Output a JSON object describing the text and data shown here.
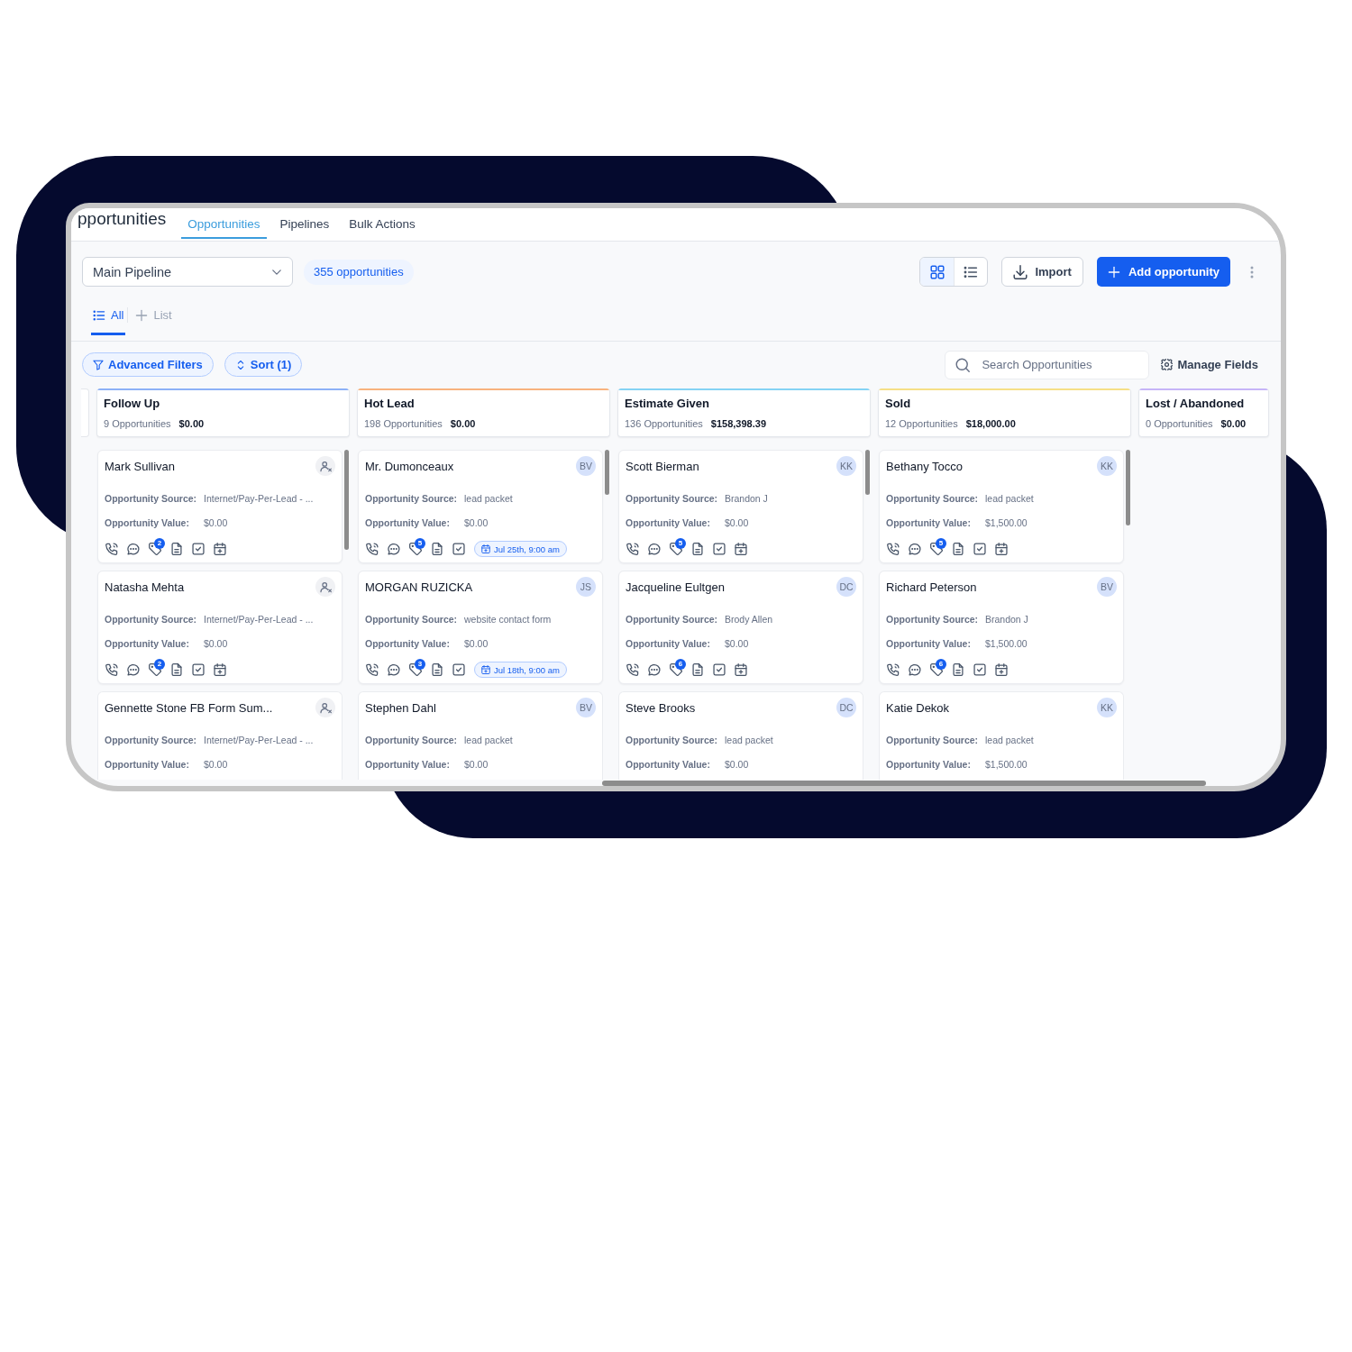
{
  "header": {
    "title": "pportunities",
    "tabs": [
      {
        "label": "Opportunities",
        "selected": true
      },
      {
        "label": "Pipelines",
        "selected": false
      },
      {
        "label": "Bulk Actions",
        "selected": false
      }
    ]
  },
  "toolbar": {
    "pipeline": "Main Pipeline",
    "count": "355 opportunities",
    "view_modes": [
      {
        "kind": "grid",
        "selected": true
      },
      {
        "kind": "list",
        "selected": false
      }
    ],
    "import_button": "Import",
    "add_button": "Add opportunity"
  },
  "list_tabs": {
    "tabs": [
      {
        "label": "All",
        "selected": true
      }
    ],
    "add_list": "List"
  },
  "filters": {
    "buttons": [
      {
        "label": "Advanced Filters",
        "kind": "filter"
      },
      {
        "label": "Sort (1)",
        "kind": "sort"
      }
    ],
    "search": {
      "placeholder": "Search Opportunities"
    },
    "manage_fields": "Manage Fields"
  },
  "board": {
    "columns": [
      {
        "title": "Follow Up",
        "count": "9 Opportunities",
        "total": "$0.00",
        "color": "#8db1f7",
        "cards": [
          {
            "name": "Mark Sullivan",
            "assigned": false,
            "fields": [
              {
                "label": "Opportunity Source:",
                "value": "Internet/Pay-Per-Lead - ..."
              },
              {
                "label": "Opportunity Value:",
                "value": "$0.00"
              }
            ],
            "badge": "2"
          },
          {
            "name": "Natasha Mehta",
            "assigned": false,
            "fields": [
              {
                "label": "Opportunity Source:",
                "value": "Internet/Pay-Per-Lead - ..."
              },
              {
                "label": "Opportunity Value:",
                "value": "$0.00"
              }
            ],
            "badge": "2"
          },
          {
            "name": "Gennette Stone FB Form Sum...",
            "assigned": false,
            "fields": [
              {
                "label": "Opportunity Source:",
                "value": "Internet/Pay-Per-Lead - ..."
              },
              {
                "label": "Opportunity Value:",
                "value": "$0.00"
              }
            ]
          }
        ]
      },
      {
        "title": "Hot Lead",
        "count": "198 Opportunities",
        "total": "$0.00",
        "color": "#f8b37e",
        "cards": [
          {
            "name": "Mr. Dumonceaux",
            "assigned": true,
            "assignee": "BV",
            "fields": [
              {
                "label": "Opportunity Source:",
                "value": "lead packet"
              },
              {
                "label": "Opportunity Value:",
                "value": "$0.00"
              }
            ],
            "badge": "5",
            "appointment": "Jul 25th, 9:00 am"
          },
          {
            "name": "MORGAN RUZICKA",
            "assigned": true,
            "assignee": "JS",
            "fields": [
              {
                "label": "Opportunity Source:",
                "value": "website contact form"
              },
              {
                "label": "Opportunity Value:",
                "value": "$0.00"
              }
            ],
            "badge": "3",
            "appointment": "Jul 18th, 9:00 am"
          },
          {
            "name": "Stephen Dahl",
            "assigned": true,
            "assignee": "BV",
            "fields": [
              {
                "label": "Opportunity Source:",
                "value": "lead packet"
              },
              {
                "label": "Opportunity Value:",
                "value": "$0.00"
              }
            ]
          }
        ]
      },
      {
        "title": "Estimate Given",
        "count": "136 Opportunities",
        "total": "$158,398.39",
        "color": "#85d3f4",
        "cards": [
          {
            "name": "Scott Bierman",
            "assigned": true,
            "assignee": "KK",
            "fields": [
              {
                "label": "Opportunity Source:",
                "value": "Brandon J"
              },
              {
                "label": "Opportunity Value:",
                "value": "$0.00"
              }
            ],
            "badge": "5"
          },
          {
            "name": "Jacqueline Eultgen",
            "assigned": true,
            "assignee": "DC",
            "fields": [
              {
                "label": "Opportunity Source:",
                "value": "Brody Allen"
              },
              {
                "label": "Opportunity Value:",
                "value": "$0.00"
              }
            ],
            "badge": "6"
          },
          {
            "name": "Steve Brooks",
            "assigned": true,
            "assignee": "DC",
            "fields": [
              {
                "label": "Opportunity Source:",
                "value": "lead packet"
              },
              {
                "label": "Opportunity Value:",
                "value": "$0.00"
              }
            ]
          }
        ]
      },
      {
        "title": "Sold",
        "count": "12 Opportunities",
        "total": "$18,000.00",
        "color": "#f6df86",
        "cards": [
          {
            "name": "Bethany Tocco",
            "assigned": true,
            "assignee": "KK",
            "fields": [
              {
                "label": "Opportunity Source:",
                "value": "lead packet"
              },
              {
                "label": "Opportunity Value:",
                "value": "$1,500.00"
              }
            ],
            "badge": "5"
          },
          {
            "name": "Richard Peterson",
            "assigned": true,
            "assignee": "BV",
            "fields": [
              {
                "label": "Opportunity Source:",
                "value": "Brandon J"
              },
              {
                "label": "Opportunity Value:",
                "value": "$1,500.00"
              }
            ],
            "badge": "6"
          },
          {
            "name": "Katie Dekok",
            "assigned": true,
            "assignee": "KK",
            "fields": [
              {
                "label": "Opportunity Source:",
                "value": "lead packet"
              },
              {
                "label": "Opportunity Value:",
                "value": "$1,500.00"
              }
            ]
          }
        ]
      },
      {
        "title": "Lost / Abandoned",
        "count": "0 Opportunities",
        "total": "$0.00",
        "color": "#c6b5f8"
      }
    ]
  }
}
